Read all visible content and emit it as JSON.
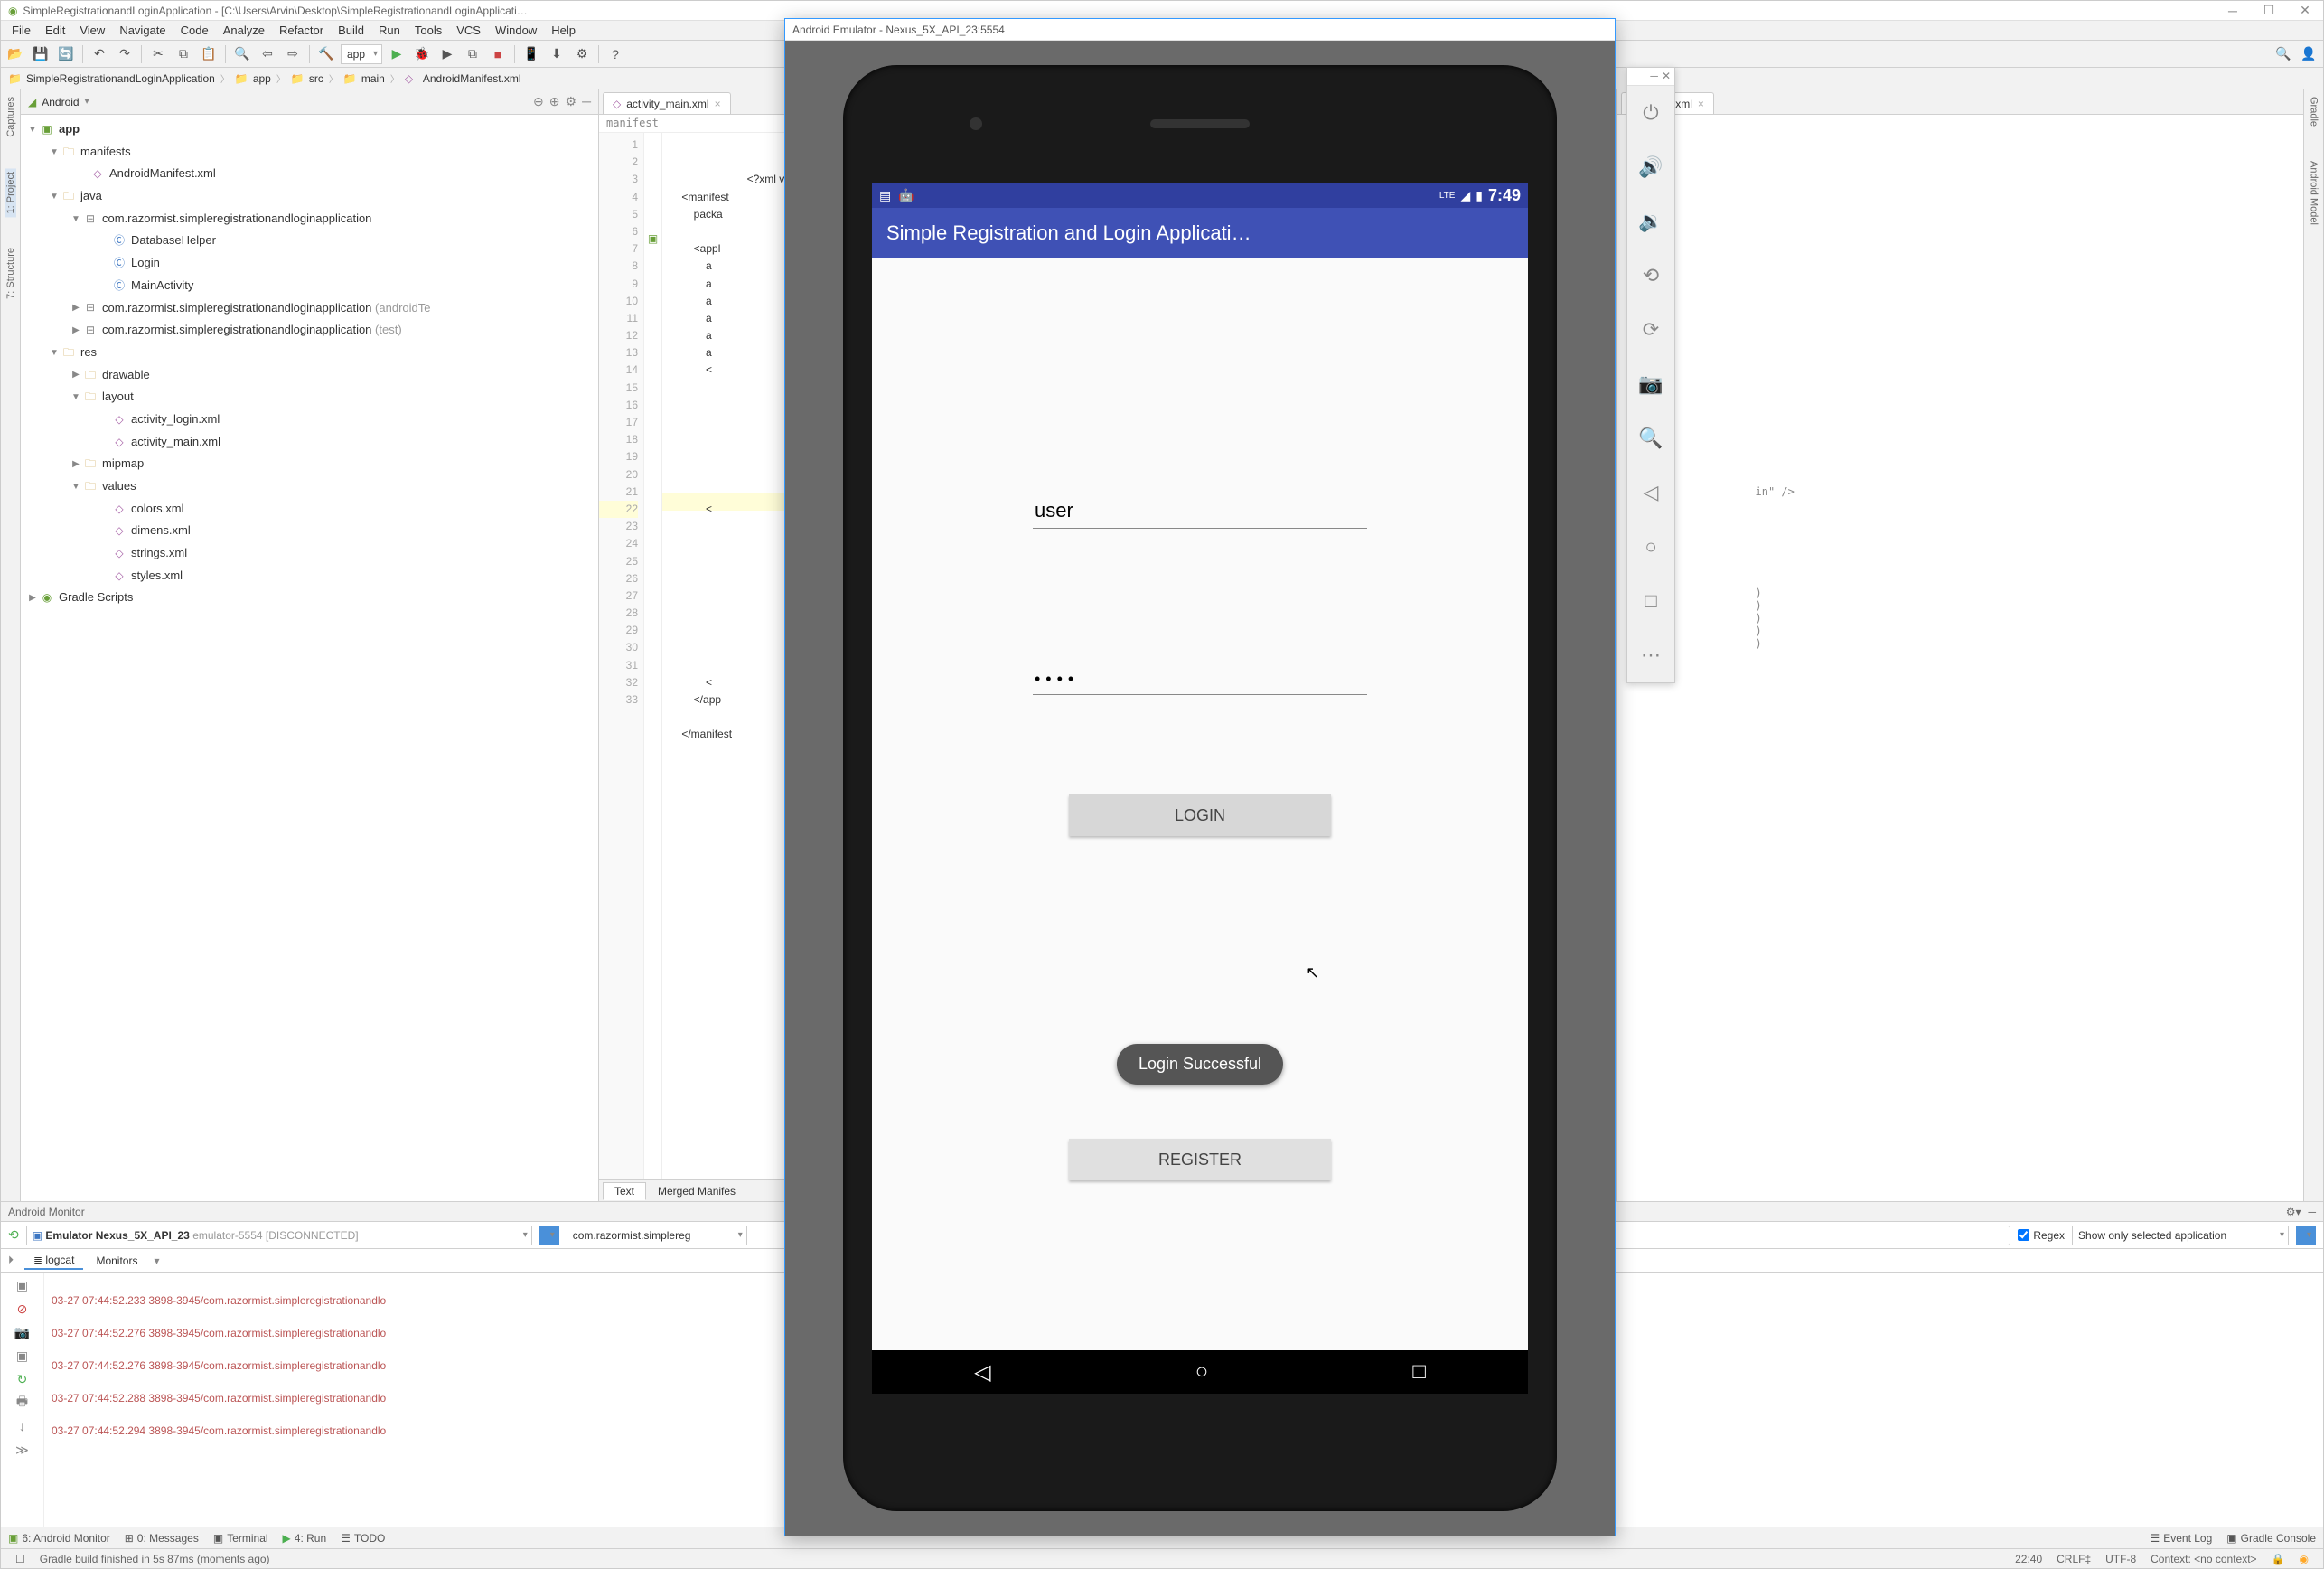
{
  "ide": {
    "window_title": "SimpleRegistrationandLoginApplication - [C:\\Users\\Arvin\\Desktop\\SimpleRegistrationandLoginApplicati…",
    "menu": [
      "File",
      "Edit",
      "View",
      "Navigate",
      "Code",
      "Analyze",
      "Refactor",
      "Build",
      "Run",
      "Tools",
      "VCS",
      "Window",
      "Help"
    ],
    "run_config": "app",
    "breadcrumb": [
      "SimpleRegistrationandLoginApplication",
      "app",
      "src",
      "main",
      "AndroidManifest.xml"
    ],
    "side_tabs_left": [
      "Captures",
      "1: Project",
      "7: Structure"
    ],
    "side_tabs_right": [
      "Gradle",
      "Android Model"
    ],
    "project_view_mode": "Android",
    "tree": {
      "app": "app",
      "manifests": "manifests",
      "manifest_file": "AndroidManifest.xml",
      "java": "java",
      "pkg_main": "com.razormist.simpleregistrationandloginapplication",
      "classes": [
        "DatabaseHelper",
        "Login",
        "MainActivity"
      ],
      "pkg_androidtest": "com.razormist.simpleregistrationandloginapplication",
      "pkg_androidtest_suffix": "(androidTe",
      "pkg_test": "com.razormist.simpleregistrationandloginapplication",
      "pkg_test_suffix": "(test)",
      "res": "res",
      "drawable": "drawable",
      "layout": "layout",
      "layout_files": [
        "activity_login.xml",
        "activity_main.xml"
      ],
      "mipmap": "mipmap",
      "values": "values",
      "values_files": [
        "colors.xml",
        "dimens.xml",
        "strings.xml",
        "styles.xml"
      ],
      "gradle_scripts": "Gradle Scripts"
    },
    "editor": {
      "tab_main": "activity_main.xml",
      "tab_right": "styles.xml",
      "breadcrumb_editor": "manifest",
      "gutter_lines": [
        "1",
        "2",
        "3",
        "4",
        "5",
        "6",
        "7",
        "8",
        "9",
        "10",
        "11",
        "12",
        "13",
        "14",
        "15",
        "16",
        "17",
        "18",
        "19",
        "20",
        "21",
        "22",
        "23",
        "24",
        "25",
        "26",
        "27",
        "28",
        "29",
        "30",
        "31",
        "32",
        "33"
      ],
      "hl_line_index": 21,
      "code_visible": "    <?xml ver\n    <manifest\n        packa\n\n        <appl\n            a\n            a\n            a\n            a\n            a\n            a\n            <\n\n\n\n\n\n\n\n            <\n\n\n\n\n\n\n\n\n\n            <\n        </app\n\n    </manifest",
      "bottom_tabs": [
        "Text",
        "Merged Manifes"
      ],
      "right_partial": "ife\n\n\n\n\n\n\n\n\n\n\n\n\n\n\n\n\n\n\n\n\n\n\n\n\n\n\n\n\n                    in\" />\n\n\n\n\n\n\n\n                    )\n                    )\n                    )\n                    )\n                    )"
    },
    "monitor": {
      "title": "Android Monitor",
      "device_select": "Emulator Nexus_5X_API_23",
      "device_suffix": "emulator-5554 [DISCONNECTED]",
      "process_select": "com.razormist.simplereg",
      "tabs": [
        "logcat",
        "Monitors"
      ],
      "side_buttons": [
        "⏯",
        "⏹",
        "📷",
        "↻",
        "⏮",
        "?",
        "⚙",
        "↓",
        "≫"
      ],
      "log_lines": [
        "03-27 07:44:52.233 3898-3945/com.razormist.simpleregistrationandlo",
        "03-27 07:44:52.276 3898-3945/com.razormist.simpleregistrationandlo",
        "03-27 07:44:52.276 3898-3945/com.razormist.simpleregistrationandlo",
        "03-27 07:44:52.288 3898-3945/com.razormist.simpleregistrationandlo",
        "03-27 07:44:52.294 3898-3945/com.razormist.simpleregistrationandlo"
      ],
      "search_placeholder": "",
      "regex_label": "Regex",
      "filter_select": "Show only selected application"
    },
    "tool_buttons": {
      "left": [
        "6: Android Monitor",
        "0: Messages",
        "Terminal",
        "4: Run",
        "TODO"
      ],
      "right": [
        "Event Log",
        "Gradle Console"
      ]
    },
    "status": {
      "msg": "Gradle build finished in 5s 87ms (moments ago)",
      "pos": "22:40",
      "lineend": "CRLF‡",
      "enc": "UTF-8",
      "context": "Context: <no context>"
    }
  },
  "emulator": {
    "window_title": "Android Emulator - Nexus_5X_API_23:5554",
    "status_time": "7:49",
    "status_lte": "LTE",
    "app_title": "Simple Registration and Login Applicati…",
    "username_value": "user",
    "password_value": "••••",
    "login_btn": "LOGIN",
    "register_btn": "REGISTER",
    "toast": "Login Successful",
    "tools": [
      "power",
      "vol-up",
      "vol-down",
      "rotate-left",
      "rotate-right",
      "camera",
      "zoom",
      "back",
      "home",
      "overview",
      "more"
    ]
  }
}
